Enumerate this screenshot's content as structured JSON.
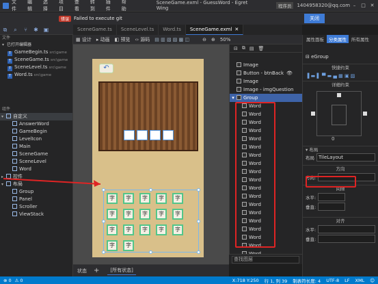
{
  "menu": [
    "文件",
    "编辑",
    "选择",
    "项目",
    "查看",
    "转到",
    "插件",
    "帮助"
  ],
  "window_title": "SceneGame.exml - GuessWord - Egret Wing",
  "badge": "程序员",
  "account": "1404958320@qq.com",
  "error": {
    "badge": "错误",
    "message": "Failed to execute git",
    "close_label": "关闭"
  },
  "tabs": [
    {
      "label": "SceneGame.ts"
    },
    {
      "label": "SceneLevel.ts"
    },
    {
      "label": "Word.ts"
    },
    {
      "label": "SceneGame.exml",
      "active": true
    }
  ],
  "editor_toolbar": {
    "design": "设计",
    "anim": "动画",
    "preview": "预览",
    "source": "源码",
    "zoom": "50%"
  },
  "left": {
    "files_header": "文件",
    "open_header": "已打开编辑器",
    "open_files": [
      {
        "name": "GameBegin.ts",
        "path": "src\\game"
      },
      {
        "name": "SceneGame.ts",
        "path": "src\\game"
      },
      {
        "name": "SceneLevel.ts",
        "path": "src\\game"
      },
      {
        "name": "Word.ts",
        "path": "src\\game"
      }
    ],
    "components_header": "组件",
    "custom_group": "自定义",
    "custom_items": [
      "AnswerWord",
      "GameBegin",
      "LevelIcon",
      "Main",
      "SceneGame",
      "SceneLevel",
      "Word"
    ],
    "controls_group": "控件",
    "layout_group": "布局",
    "layout_items": [
      "Group",
      "Panel",
      "Scroller",
      "ViewStack"
    ]
  },
  "canvas": {
    "cell_char": "字",
    "back_icon": "back-arrow"
  },
  "layers": {
    "items": [
      {
        "label": "Image",
        "type": "image"
      },
      {
        "label": "Button - btnBack",
        "type": "button"
      },
      {
        "label": "Image",
        "type": "image"
      },
      {
        "label": "Image - imgQuestion",
        "type": "image"
      },
      {
        "label": "Group",
        "type": "group",
        "selected": true
      }
    ],
    "children": [
      "Word",
      "Word",
      "Word",
      "Word",
      "Word",
      "Word",
      "Word",
      "Word",
      "Word",
      "Word",
      "Word",
      "Word",
      "Word",
      "Word",
      "Word",
      "Word",
      "Word",
      "Word",
      "Word",
      "Word"
    ],
    "search_placeholder": "查找图层"
  },
  "right": {
    "tabs": [
      "属性面板",
      "分类属性",
      "所有属性"
    ],
    "component": "eGroup",
    "quick_constraint": "快捷约束",
    "detail_constraint": "详细约束",
    "constraint_value": "0",
    "layout_header": "布局",
    "layout_label": "布局",
    "layout_value": "TileLayout",
    "direction_header": "方向",
    "direction_label": "方向:",
    "gap_header": "间隙",
    "h_label": "水平:",
    "v_label": "垂直:",
    "align_header": "对齐",
    "h_align_label": "水平:",
    "v_align_label": "垂直:"
  },
  "bottom": {
    "state_label": "状态",
    "all_states": "[所有状态]"
  },
  "status": {
    "errors": "0",
    "warnings": "0",
    "coords": "X:718 Y:250",
    "position": "行 1, 列 39",
    "tab_size": "制表符长度: 4",
    "encoding": "UTF-8",
    "eol": "LF",
    "lang": "XML"
  },
  "colors": {
    "accent": "#3e7bd6",
    "error": "#c0392b",
    "annotation": "#e02424",
    "status": "#007acc"
  }
}
